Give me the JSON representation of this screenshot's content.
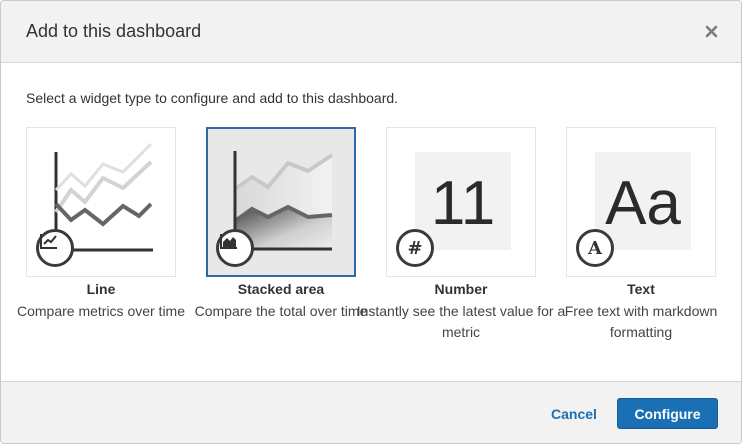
{
  "dialog": {
    "title": "Add to this dashboard",
    "instructions": "Select a widget type to configure and add to this dashboard."
  },
  "widgets": [
    {
      "title": "Line",
      "description": "Compare metrics over time",
      "icon": "line-chart-icon",
      "selected": false
    },
    {
      "title": "Stacked area",
      "description": "Compare the total over time",
      "icon": "area-chart-icon",
      "selected": true
    },
    {
      "title": "Number",
      "description": "Instantly see the latest value for a metric",
      "icon": "hash-icon",
      "glyph": "#",
      "preview_value": "11",
      "selected": false
    },
    {
      "title": "Text",
      "description": "Free text with markdown formatting",
      "icon": "text-icon",
      "glyph": "A",
      "preview_value": "Aa",
      "selected": false
    }
  ],
  "footer": {
    "cancel_label": "Cancel",
    "configure_label": "Configure"
  },
  "colors": {
    "primary": "#1a6fb5",
    "selected_border": "#2e6ba6",
    "header_bg": "#f2f2f2"
  }
}
